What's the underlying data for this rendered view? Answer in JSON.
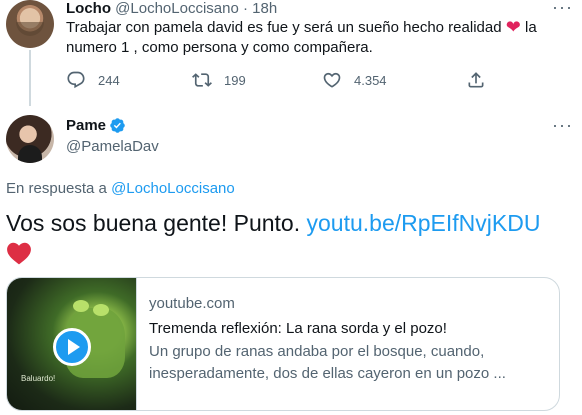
{
  "parent_tweet": {
    "name": "Locho",
    "handle": "@LochoLoccisano",
    "dot": "·",
    "time": "18h",
    "text_before_heart": "Trabajar con pamela david es fue y será un sueño hecho realidad",
    "text_after_heart": " la numero 1 , como persona y como compañera.",
    "more": "···",
    "stats": {
      "replies": "244",
      "retweets": "199",
      "likes": "4.354"
    }
  },
  "main_tweet": {
    "name": "Pame",
    "handle": "@PamelaDav",
    "more": "···",
    "reply_prefix": "En respuesta a",
    "reply_to": "@LochoLoccisano",
    "text": "Vos sos buena gente! Punto.",
    "link": "youtu.be/RpEIfNvjKDU"
  },
  "link_card": {
    "domain": "youtube.com",
    "title": "Tremenda reflexión: La rana sorda y el pozo!",
    "description": "Un grupo de ranas andaba por el bosque, cuando, inesperadamente, dos de ellas cayeron en un pozo ...",
    "thumb_caption": "Baluardo!"
  },
  "icons": {
    "reply": "reply-icon",
    "retweet": "retweet-icon",
    "like": "heart-icon",
    "share": "share-icon",
    "verified": "verified-badge-icon",
    "play": "play-icon"
  },
  "colors": {
    "link": "#1d9bf0",
    "heart": "#e0245e",
    "secondary_text": "#536471",
    "border": "#cfd9de"
  }
}
